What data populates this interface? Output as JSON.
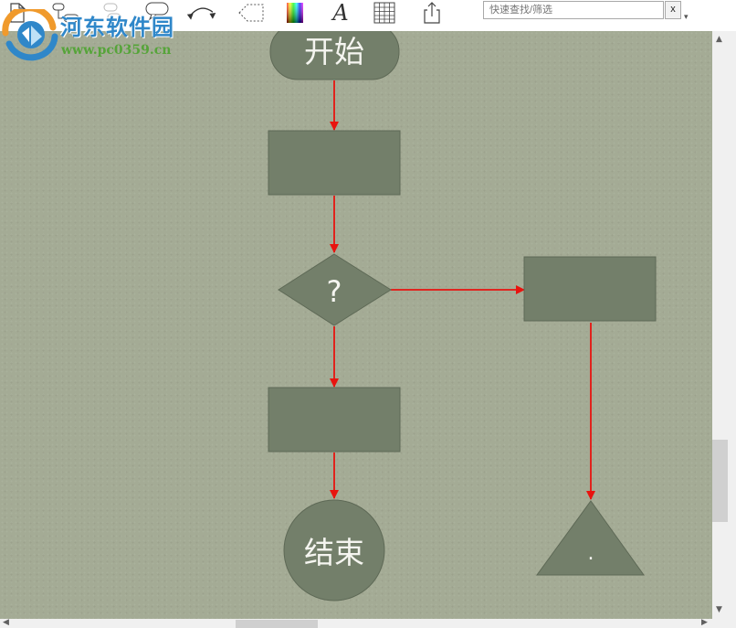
{
  "watermark": {
    "title": "河东软件园",
    "url": "www.pc0359.cn"
  },
  "toolbar": {
    "tools": [
      {
        "name": "new-document-icon"
      },
      {
        "name": "add-node-icon"
      },
      {
        "name": "add-child-node-icon"
      },
      {
        "name": "speech-bubble-icon"
      },
      {
        "name": "connector-curve-icon"
      },
      {
        "name": "boundary-shape-icon"
      },
      {
        "name": "color-palette-icon"
      },
      {
        "name": "font-icon"
      },
      {
        "name": "table-icon"
      },
      {
        "name": "export-share-icon"
      }
    ],
    "font_glyph": "A",
    "search": {
      "placeholder": "快速查找/筛选",
      "clear_label": "x"
    },
    "overflow_glyph": "▾"
  },
  "flowchart": {
    "start_label": "开始",
    "decision_label": "?",
    "end_label": "结束",
    "terminal_label": ".",
    "node_fill": "#737f6a",
    "arrow_color": "#e8130f"
  },
  "scrollbars": {
    "up_glyph": "▲",
    "down_glyph": "▼",
    "left_glyph": "◀",
    "right_glyph": "▶"
  }
}
